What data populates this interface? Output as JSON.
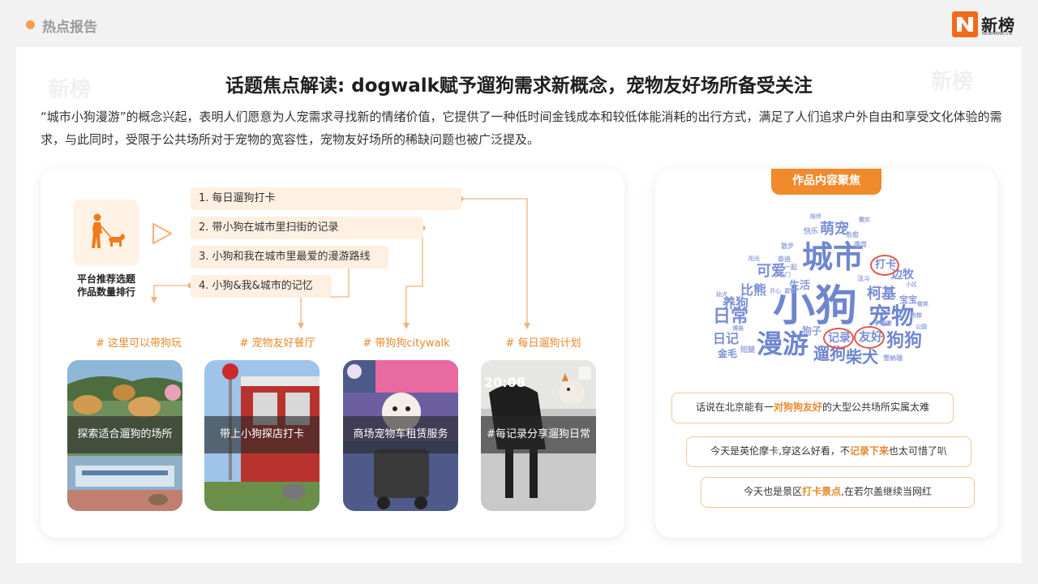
{
  "header": {
    "section": "热点报告",
    "logo_text": "新榜",
    "logo_sub": "NEWRANK.CN"
  },
  "slide": {
    "title": "话题焦点解读: dogwalk赋予遛狗需求新概念，宠物友好场所备受关注",
    "intro": "“城市小狗漫游”的概念兴起，表明人们愿意为人宠需求寻找新的情绪价值，它提供了一种低时间金钱成本和较低体能消耗的出行方式，满足了人们追求户外自由和享受文化体验的需求，与此同时，受限于公共场所对于宠物的宽容性，宠物友好场所的稀缺问题也被广泛提及。"
  },
  "ranking": {
    "label_line1": "平台推荐选题",
    "label_line2": "作品数量排行",
    "topics": [
      "1. 每日遛狗打卡",
      "2. 带小狗在城市里扫街的记录",
      "3. 小狗和我在城市里最爱的漫游路线",
      "4. 小狗&我&城市的记忆"
    ]
  },
  "tags": [
    "# 这里可以带狗玩",
    "# 宠物友好餐厅",
    "# 带狗狗citywalk",
    "# 每日遛狗计划"
  ],
  "photos": [
    {
      "caption": "探索适合遛狗的场所",
      "icon": "dogs-outdoor-photo"
    },
    {
      "caption": "带上小狗探店打卡",
      "icon": "restaurant-dog-photo"
    },
    {
      "caption": "商场宠物车租赁服务",
      "icon": "mall-stroller-photo"
    },
    {
      "caption": "#每记录分享遛狗日常",
      "time": "20:08",
      "icon": "dog-walk-photo"
    }
  ],
  "focus": {
    "title": "作品内容聚焦",
    "words": {
      "big1": "小狗",
      "big2": "城市",
      "big3": "漫游",
      "big4": "宠物",
      "big5": "日常",
      "m1": "萌宠",
      "m2": "可爱",
      "m3": "比熊",
      "m4": "生活",
      "m5": "养狗",
      "m6": "柯基",
      "m7": "狗狗",
      "m8": "遛狗",
      "m9": "柴犬",
      "m10": "日记",
      "m11": "打卡",
      "m12": "记录",
      "m13": "友好",
      "m14": "狗子",
      "m15": "边牧",
      "m16": "金毛",
      "m17": "宝宝",
      "s1": "快乐",
      "s2": "泰迪",
      "s3": "一起",
      "s4": "短腿",
      "s5": "雪纳瑞",
      "s6": "萨摩耶",
      "s7": "法斗",
      "s8": "出门",
      "s9": "喜欢",
      "s10": "博美",
      "s11": "治愈",
      "s12": "幼犬",
      "s13": "公园",
      "s14": "开心",
      "s15": "狗粮",
      "s16": "遛弯",
      "s17": "散步",
      "s18": "撒欢",
      "s19": "小区",
      "s20": "阳光",
      "s21": "微笑",
      "s22": "陪伴"
    },
    "comments": [
      {
        "pre": "话说在北京能有一",
        "hl": "对狗狗友好",
        "post": "的大型公共场所实属太难"
      },
      {
        "pre": "今天是英伦摩卡,穿这么好看，不",
        "hl": "记录下来",
        "post": "也太可惜了叭"
      },
      {
        "pre": "今天也是景区",
        "hl": "打卡景点",
        "post": ",在若尔盖继续当网红"
      }
    ]
  },
  "colors": {
    "accent": "#f08a2c",
    "topic_bg": "#fff0e2",
    "cloud_blue": "#6f86cf",
    "cloud_dark": "#4a5db0",
    "highlight_circle": "#e05a4a"
  }
}
